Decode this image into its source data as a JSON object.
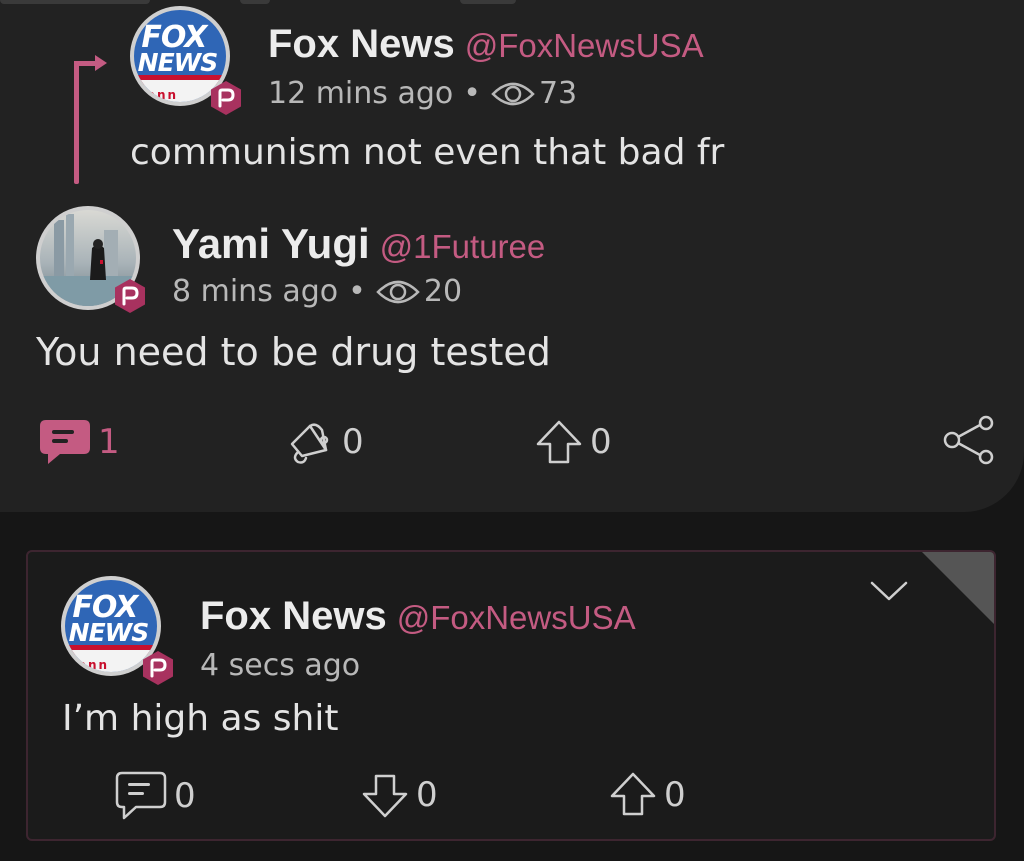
{
  "parent_post": {
    "author_name": "Fox News",
    "author_handle": "@FoxNewsUSA",
    "timestamp": "12 mins ago",
    "views": "73",
    "text": "communism not even that bad fr"
  },
  "main_post": {
    "author_name": "Yami Yugi",
    "author_handle": "@1Futuree",
    "timestamp": "8 mins ago",
    "views": "20",
    "text": "You need to be drug tested",
    "actions": {
      "comments": "1",
      "echoes": "0",
      "upvotes": "0"
    }
  },
  "reply_post": {
    "author_name": "Fox News",
    "author_handle": "@FoxNewsUSA",
    "timestamp": "4 secs ago",
    "text": "I’m high as shit",
    "actions": {
      "comments": "0",
      "downvotes": "0",
      "upvotes": "0"
    }
  },
  "fox_logo": {
    "line1": "FOX",
    "line2": "NEWS",
    "line3": "ann"
  },
  "colors": {
    "accent": "#c45b82",
    "badge": "#a8325f",
    "card_bg": "#222222",
    "page_bg": "#161616"
  },
  "icons": {
    "views": "eye-icon",
    "comment": "comment-icon",
    "echo": "megaphone-icon",
    "upvote": "arrow-up-icon",
    "downvote": "arrow-down-icon",
    "share": "share-icon",
    "menu": "chevron-down-icon",
    "verified": "parler-badge-icon"
  }
}
